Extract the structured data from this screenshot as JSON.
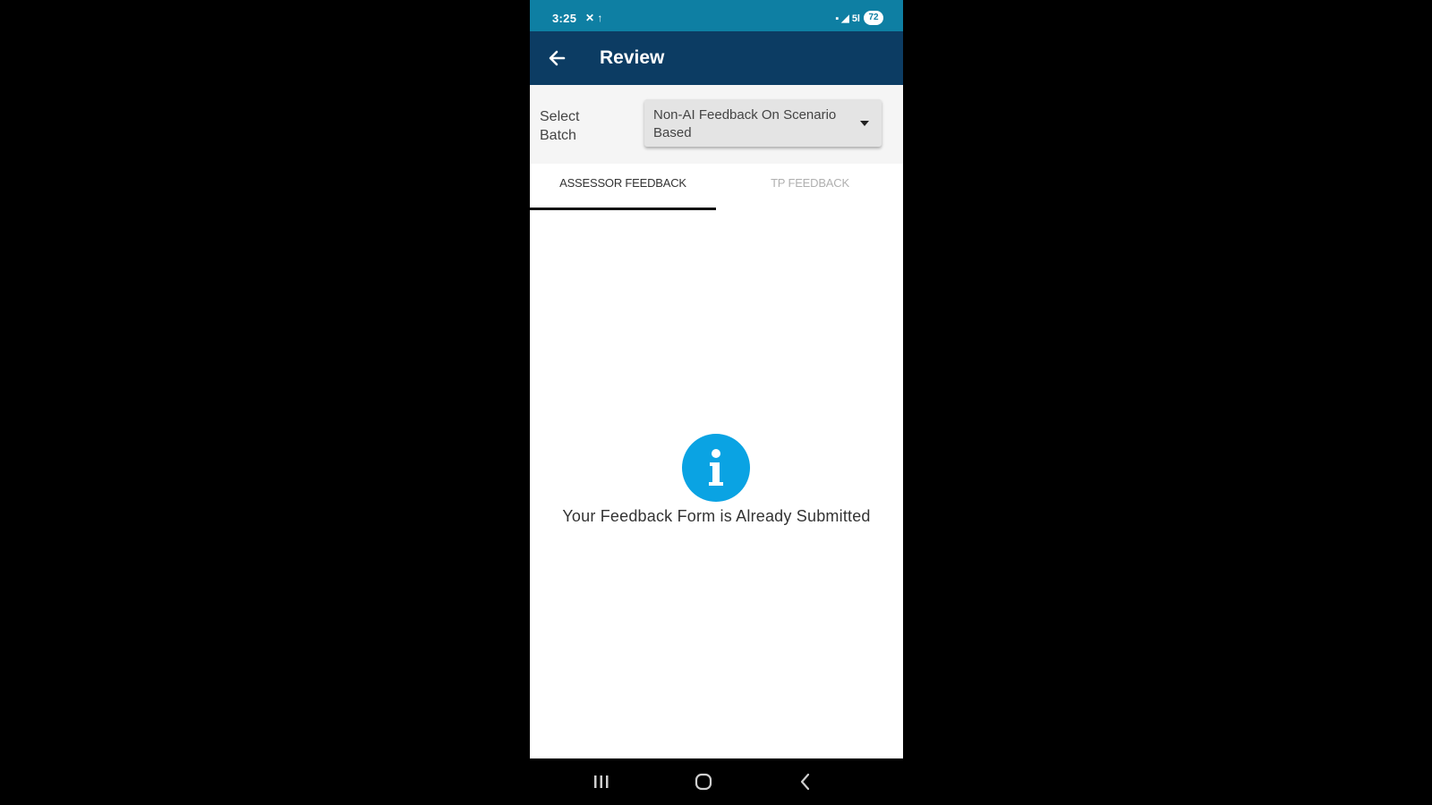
{
  "status_bar": {
    "time": "3:25",
    "left_icons": "✕ ↑",
    "right_icons": "▪ ◢ 5l",
    "battery": "72"
  },
  "app_bar": {
    "title": "Review",
    "back_icon": "arrow-left-icon"
  },
  "batch": {
    "label": "Select Batch",
    "selected_value": "Non-AI Feedback On Scenario Based"
  },
  "tabs": [
    {
      "label": "ASSESSOR FEEDBACK",
      "active": true
    },
    {
      "label": "TP FEEDBACK",
      "active": false
    }
  ],
  "content": {
    "icon": "info-icon",
    "message": "Your Feedback Form is Already Submitted"
  },
  "nav_bar": {
    "recents_icon": "recents-icon",
    "home_icon": "home-icon",
    "back_icon": "back-chevron-icon"
  },
  "colors": {
    "status_bar": "#0e7fa3",
    "app_bar": "#0c3c63",
    "info_icon": "#0aa3e3",
    "active_tab_indicator": "#111111",
    "background": "#000000"
  }
}
